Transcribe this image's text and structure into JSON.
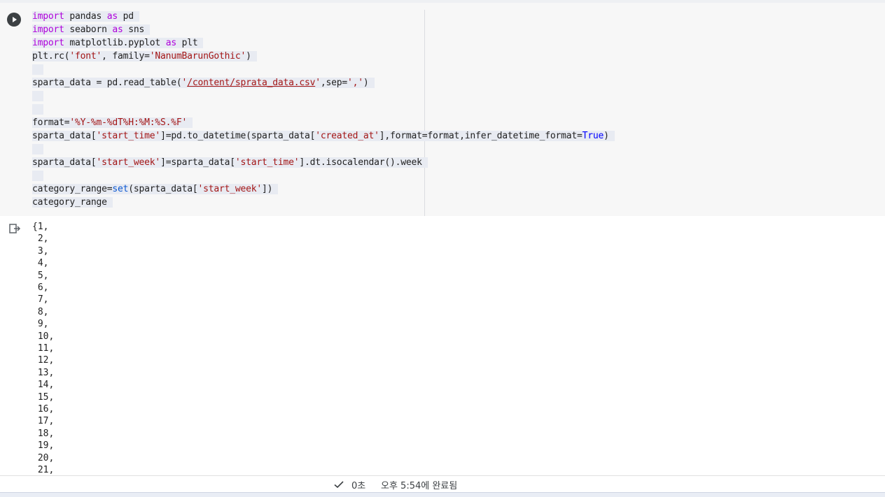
{
  "code_lines": [
    {
      "segments": [
        {
          "t": "import",
          "c": "kw"
        },
        {
          "t": " pandas ",
          "c": ""
        },
        {
          "t": "as",
          "c": "kw"
        },
        {
          "t": " pd",
          "c": ""
        }
      ]
    },
    {
      "segments": [
        {
          "t": "import",
          "c": "kw"
        },
        {
          "t": " seaborn ",
          "c": ""
        },
        {
          "t": "as",
          "c": "kw"
        },
        {
          "t": " sns",
          "c": ""
        }
      ]
    },
    {
      "segments": [
        {
          "t": "import",
          "c": "kw"
        },
        {
          "t": " matplotlib.pyplot ",
          "c": ""
        },
        {
          "t": "as",
          "c": "kw"
        },
        {
          "t": " plt",
          "c": ""
        }
      ]
    },
    {
      "segments": [
        {
          "t": "plt.rc(",
          "c": ""
        },
        {
          "t": "'font'",
          "c": "st"
        },
        {
          "t": ", family=",
          "c": ""
        },
        {
          "t": "'NanumBarunGothic'",
          "c": "st"
        },
        {
          "t": ")",
          "c": ""
        }
      ]
    },
    {
      "segments": []
    },
    {
      "segments": [
        {
          "t": "sparta_data = pd.read_table(",
          "c": ""
        },
        {
          "t": "'",
          "c": "st"
        },
        {
          "t": "/content/sprata_data.csv",
          "c": "st lnk"
        },
        {
          "t": "'",
          "c": "st"
        },
        {
          "t": ",sep=",
          "c": ""
        },
        {
          "t": "','",
          "c": "st"
        },
        {
          "t": ")",
          "c": ""
        }
      ]
    },
    {
      "segments": []
    },
    {
      "segments": []
    },
    {
      "segments": [
        {
          "t": "format=",
          "c": ""
        },
        {
          "t": "'%Y-%m-%dT%H:%M:%S.%F'",
          "c": "st"
        }
      ]
    },
    {
      "segments": [
        {
          "t": "sparta_data[",
          "c": ""
        },
        {
          "t": "'start_time'",
          "c": "st"
        },
        {
          "t": "]=pd.to_datetime(sparta_data[",
          "c": ""
        },
        {
          "t": "'created_at'",
          "c": "st"
        },
        {
          "t": "],format=format,infer_datetime_format=",
          "c": ""
        },
        {
          "t": "True",
          "c": "bl"
        },
        {
          "t": ")",
          "c": ""
        }
      ]
    },
    {
      "segments": []
    },
    {
      "segments": [
        {
          "t": "sparta_data[",
          "c": ""
        },
        {
          "t": "'start_week'",
          "c": "st"
        },
        {
          "t": "]=sparta_data[",
          "c": ""
        },
        {
          "t": "'start_time'",
          "c": "st"
        },
        {
          "t": "].dt.isocalendar().week",
          "c": ""
        }
      ]
    },
    {
      "segments": []
    },
    {
      "segments": [
        {
          "t": "category_range=",
          "c": ""
        },
        {
          "t": "set",
          "c": "bi"
        },
        {
          "t": "(sparta_data[",
          "c": ""
        },
        {
          "t": "'start_week'",
          "c": "st"
        },
        {
          "t": "])",
          "c": ""
        }
      ]
    },
    {
      "segments": [
        {
          "t": "category_range",
          "c": ""
        }
      ]
    }
  ],
  "output_lines": [
    "{1,",
    " 2,",
    " 3,",
    " 4,",
    " 5,",
    " 6,",
    " 7,",
    " 8,",
    " 9,",
    " 10,",
    " 11,",
    " 12,",
    " 13,",
    " 14,",
    " 15,",
    " 16,",
    " 17,",
    " 18,",
    " 19,",
    " 20,",
    " 21,"
  ],
  "status": {
    "duration": "0초",
    "completed": "오후 5:54에 완료됨"
  },
  "icons": {
    "run": "play-circle-icon",
    "output": "output-redirect-icon",
    "status": "check-icon"
  }
}
